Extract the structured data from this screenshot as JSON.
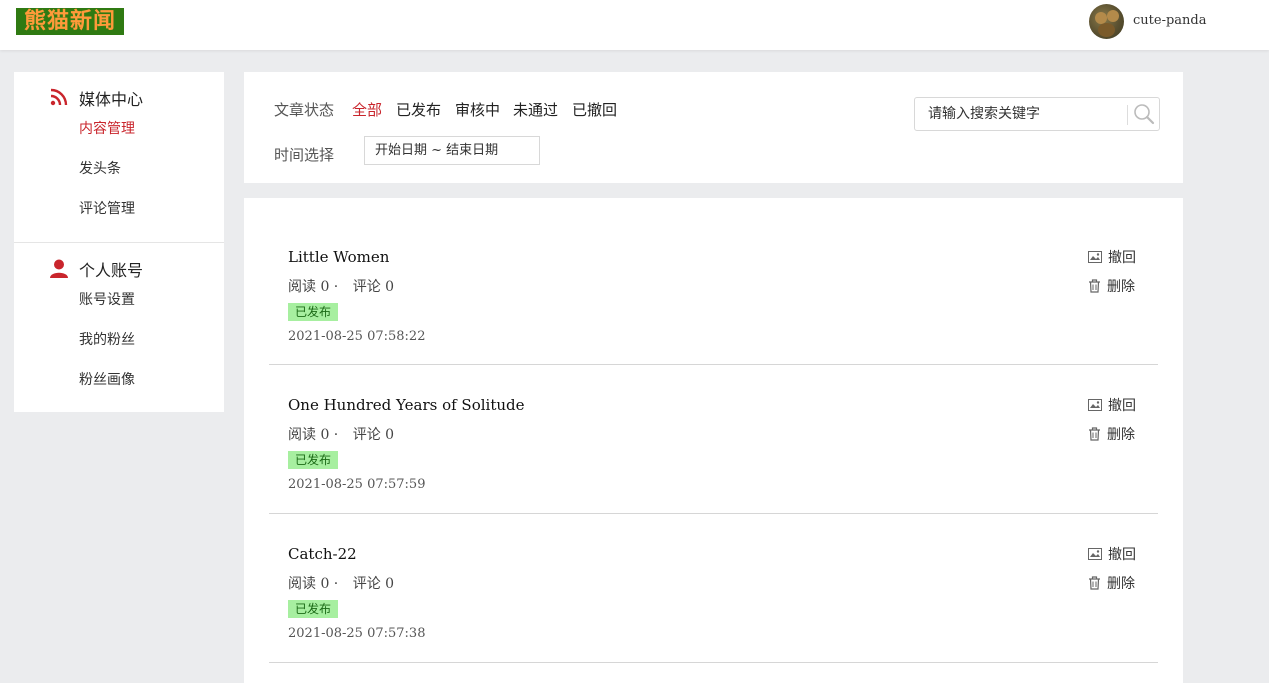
{
  "header": {
    "logo_text": "熊猫新闻",
    "username": "cute-panda"
  },
  "sidebar": {
    "media": {
      "title": "媒体中心",
      "icon": "rss-icon",
      "items": [
        {
          "label": "内容管理",
          "active": true
        },
        {
          "label": "发头条",
          "active": false
        },
        {
          "label": "评论管理",
          "active": false
        }
      ]
    },
    "account": {
      "title": "个人账号",
      "icon": "user-icon",
      "items": [
        {
          "label": "账号设置",
          "active": false
        },
        {
          "label": "我的粉丝",
          "active": false
        },
        {
          "label": "粉丝画像",
          "active": false
        }
      ]
    }
  },
  "filter": {
    "status_label": "文章状态",
    "status_options": [
      "全部",
      "已发布",
      "审核中",
      "未通过",
      "已撤回"
    ],
    "active_status": "全部",
    "time_label": "时间选择",
    "date_range": "开始日期 ~ 结束日期",
    "search_placeholder": "请输入搜索关键字"
  },
  "articles": [
    {
      "title": "Little Women",
      "reads": "阅读 0 ·",
      "comments": "评论 0",
      "status": "已发布",
      "time": "2021-08-25 07:58:22"
    },
    {
      "title": "One Hundred Years of Solitude",
      "reads": "阅读 0 ·",
      "comments": "评论 0",
      "status": "已发布",
      "time": "2021-08-25 07:57:59"
    },
    {
      "title": "Catch-22",
      "reads": "阅读 0 ·",
      "comments": "评论 0",
      "status": "已发布",
      "time": "2021-08-25 07:57:38"
    }
  ],
  "actions": {
    "withdraw": "撤回",
    "delete": "删除"
  },
  "colors": {
    "accent": "#c9252c",
    "badge_bg": "#a7efa0",
    "logo_bg": "#2f7a12",
    "logo_text": "#ff9a3a"
  }
}
